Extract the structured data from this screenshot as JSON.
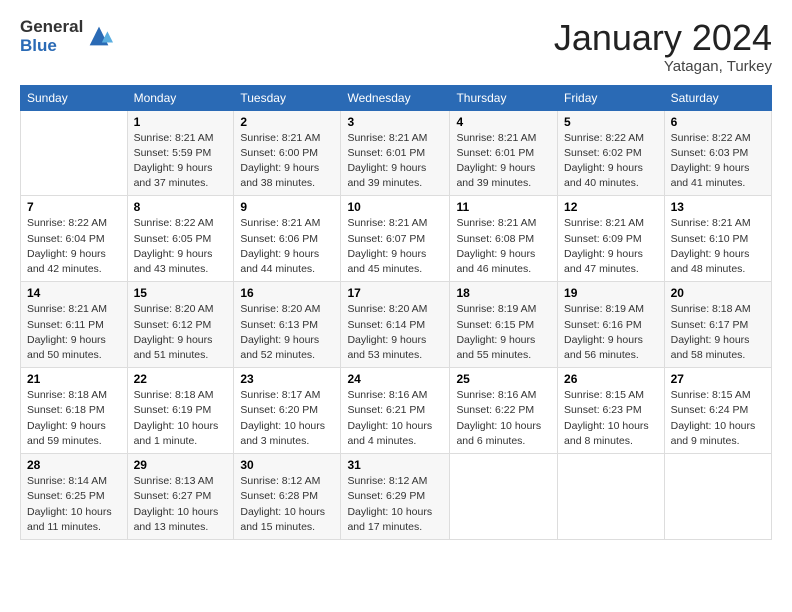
{
  "header": {
    "logo_general": "General",
    "logo_blue": "Blue",
    "title": "January 2024",
    "location": "Yatagan, Turkey"
  },
  "weekdays": [
    "Sunday",
    "Monday",
    "Tuesday",
    "Wednesday",
    "Thursday",
    "Friday",
    "Saturday"
  ],
  "weeks": [
    [
      {
        "day": "",
        "sunrise": "",
        "sunset": "",
        "daylight": ""
      },
      {
        "day": "1",
        "sunrise": "Sunrise: 8:21 AM",
        "sunset": "Sunset: 5:59 PM",
        "daylight": "Daylight: 9 hours and 37 minutes."
      },
      {
        "day": "2",
        "sunrise": "Sunrise: 8:21 AM",
        "sunset": "Sunset: 6:00 PM",
        "daylight": "Daylight: 9 hours and 38 minutes."
      },
      {
        "day": "3",
        "sunrise": "Sunrise: 8:21 AM",
        "sunset": "Sunset: 6:01 PM",
        "daylight": "Daylight: 9 hours and 39 minutes."
      },
      {
        "day": "4",
        "sunrise": "Sunrise: 8:21 AM",
        "sunset": "Sunset: 6:01 PM",
        "daylight": "Daylight: 9 hours and 39 minutes."
      },
      {
        "day": "5",
        "sunrise": "Sunrise: 8:22 AM",
        "sunset": "Sunset: 6:02 PM",
        "daylight": "Daylight: 9 hours and 40 minutes."
      },
      {
        "day": "6",
        "sunrise": "Sunrise: 8:22 AM",
        "sunset": "Sunset: 6:03 PM",
        "daylight": "Daylight: 9 hours and 41 minutes."
      }
    ],
    [
      {
        "day": "7",
        "sunrise": "Sunrise: 8:22 AM",
        "sunset": "Sunset: 6:04 PM",
        "daylight": "Daylight: 9 hours and 42 minutes."
      },
      {
        "day": "8",
        "sunrise": "Sunrise: 8:22 AM",
        "sunset": "Sunset: 6:05 PM",
        "daylight": "Daylight: 9 hours and 43 minutes."
      },
      {
        "day": "9",
        "sunrise": "Sunrise: 8:21 AM",
        "sunset": "Sunset: 6:06 PM",
        "daylight": "Daylight: 9 hours and 44 minutes."
      },
      {
        "day": "10",
        "sunrise": "Sunrise: 8:21 AM",
        "sunset": "Sunset: 6:07 PM",
        "daylight": "Daylight: 9 hours and 45 minutes."
      },
      {
        "day": "11",
        "sunrise": "Sunrise: 8:21 AM",
        "sunset": "Sunset: 6:08 PM",
        "daylight": "Daylight: 9 hours and 46 minutes."
      },
      {
        "day": "12",
        "sunrise": "Sunrise: 8:21 AM",
        "sunset": "Sunset: 6:09 PM",
        "daylight": "Daylight: 9 hours and 47 minutes."
      },
      {
        "day": "13",
        "sunrise": "Sunrise: 8:21 AM",
        "sunset": "Sunset: 6:10 PM",
        "daylight": "Daylight: 9 hours and 48 minutes."
      }
    ],
    [
      {
        "day": "14",
        "sunrise": "Sunrise: 8:21 AM",
        "sunset": "Sunset: 6:11 PM",
        "daylight": "Daylight: 9 hours and 50 minutes."
      },
      {
        "day": "15",
        "sunrise": "Sunrise: 8:20 AM",
        "sunset": "Sunset: 6:12 PM",
        "daylight": "Daylight: 9 hours and 51 minutes."
      },
      {
        "day": "16",
        "sunrise": "Sunrise: 8:20 AM",
        "sunset": "Sunset: 6:13 PM",
        "daylight": "Daylight: 9 hours and 52 minutes."
      },
      {
        "day": "17",
        "sunrise": "Sunrise: 8:20 AM",
        "sunset": "Sunset: 6:14 PM",
        "daylight": "Daylight: 9 hours and 53 minutes."
      },
      {
        "day": "18",
        "sunrise": "Sunrise: 8:19 AM",
        "sunset": "Sunset: 6:15 PM",
        "daylight": "Daylight: 9 hours and 55 minutes."
      },
      {
        "day": "19",
        "sunrise": "Sunrise: 8:19 AM",
        "sunset": "Sunset: 6:16 PM",
        "daylight": "Daylight: 9 hours and 56 minutes."
      },
      {
        "day": "20",
        "sunrise": "Sunrise: 8:18 AM",
        "sunset": "Sunset: 6:17 PM",
        "daylight": "Daylight: 9 hours and 58 minutes."
      }
    ],
    [
      {
        "day": "21",
        "sunrise": "Sunrise: 8:18 AM",
        "sunset": "Sunset: 6:18 PM",
        "daylight": "Daylight: 9 hours and 59 minutes."
      },
      {
        "day": "22",
        "sunrise": "Sunrise: 8:18 AM",
        "sunset": "Sunset: 6:19 PM",
        "daylight": "Daylight: 10 hours and 1 minute."
      },
      {
        "day": "23",
        "sunrise": "Sunrise: 8:17 AM",
        "sunset": "Sunset: 6:20 PM",
        "daylight": "Daylight: 10 hours and 3 minutes."
      },
      {
        "day": "24",
        "sunrise": "Sunrise: 8:16 AM",
        "sunset": "Sunset: 6:21 PM",
        "daylight": "Daylight: 10 hours and 4 minutes."
      },
      {
        "day": "25",
        "sunrise": "Sunrise: 8:16 AM",
        "sunset": "Sunset: 6:22 PM",
        "daylight": "Daylight: 10 hours and 6 minutes."
      },
      {
        "day": "26",
        "sunrise": "Sunrise: 8:15 AM",
        "sunset": "Sunset: 6:23 PM",
        "daylight": "Daylight: 10 hours and 8 minutes."
      },
      {
        "day": "27",
        "sunrise": "Sunrise: 8:15 AM",
        "sunset": "Sunset: 6:24 PM",
        "daylight": "Daylight: 10 hours and 9 minutes."
      }
    ],
    [
      {
        "day": "28",
        "sunrise": "Sunrise: 8:14 AM",
        "sunset": "Sunset: 6:25 PM",
        "daylight": "Daylight: 10 hours and 11 minutes."
      },
      {
        "day": "29",
        "sunrise": "Sunrise: 8:13 AM",
        "sunset": "Sunset: 6:27 PM",
        "daylight": "Daylight: 10 hours and 13 minutes."
      },
      {
        "day": "30",
        "sunrise": "Sunrise: 8:12 AM",
        "sunset": "Sunset: 6:28 PM",
        "daylight": "Daylight: 10 hours and 15 minutes."
      },
      {
        "day": "31",
        "sunrise": "Sunrise: 8:12 AM",
        "sunset": "Sunset: 6:29 PM",
        "daylight": "Daylight: 10 hours and 17 minutes."
      },
      {
        "day": "",
        "sunrise": "",
        "sunset": "",
        "daylight": ""
      },
      {
        "day": "",
        "sunrise": "",
        "sunset": "",
        "daylight": ""
      },
      {
        "day": "",
        "sunrise": "",
        "sunset": "",
        "daylight": ""
      }
    ]
  ]
}
